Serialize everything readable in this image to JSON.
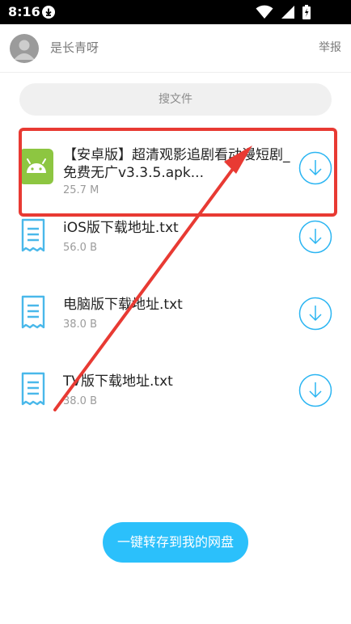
{
  "status_bar": {
    "time": "8:16"
  },
  "header": {
    "username": "是长青呀",
    "report_label": "举报"
  },
  "search": {
    "label": "搜文件"
  },
  "files": [
    {
      "name": "【安卓版】超清观影追剧看动漫短剧_免费无广v3.3.5.apk...",
      "size": "25.7 M",
      "icon": "android-icon"
    },
    {
      "name": "iOS版下载地址.txt",
      "size": "56.0 B",
      "icon": "text-file-icon"
    },
    {
      "name": "电脑版下载地址.txt",
      "size": "38.0 B",
      "icon": "text-file-icon"
    },
    {
      "name": "TV版下载地址.txt",
      "size": "38.0 B",
      "icon": "text-file-icon"
    }
  ],
  "save_button": {
    "label": "一键转存到我的网盘"
  },
  "colors": {
    "accent": "#2bc0fb",
    "download_icon": "#2bb5f2",
    "annotation_red": "#e83a33",
    "android_green": "#8dc641"
  }
}
